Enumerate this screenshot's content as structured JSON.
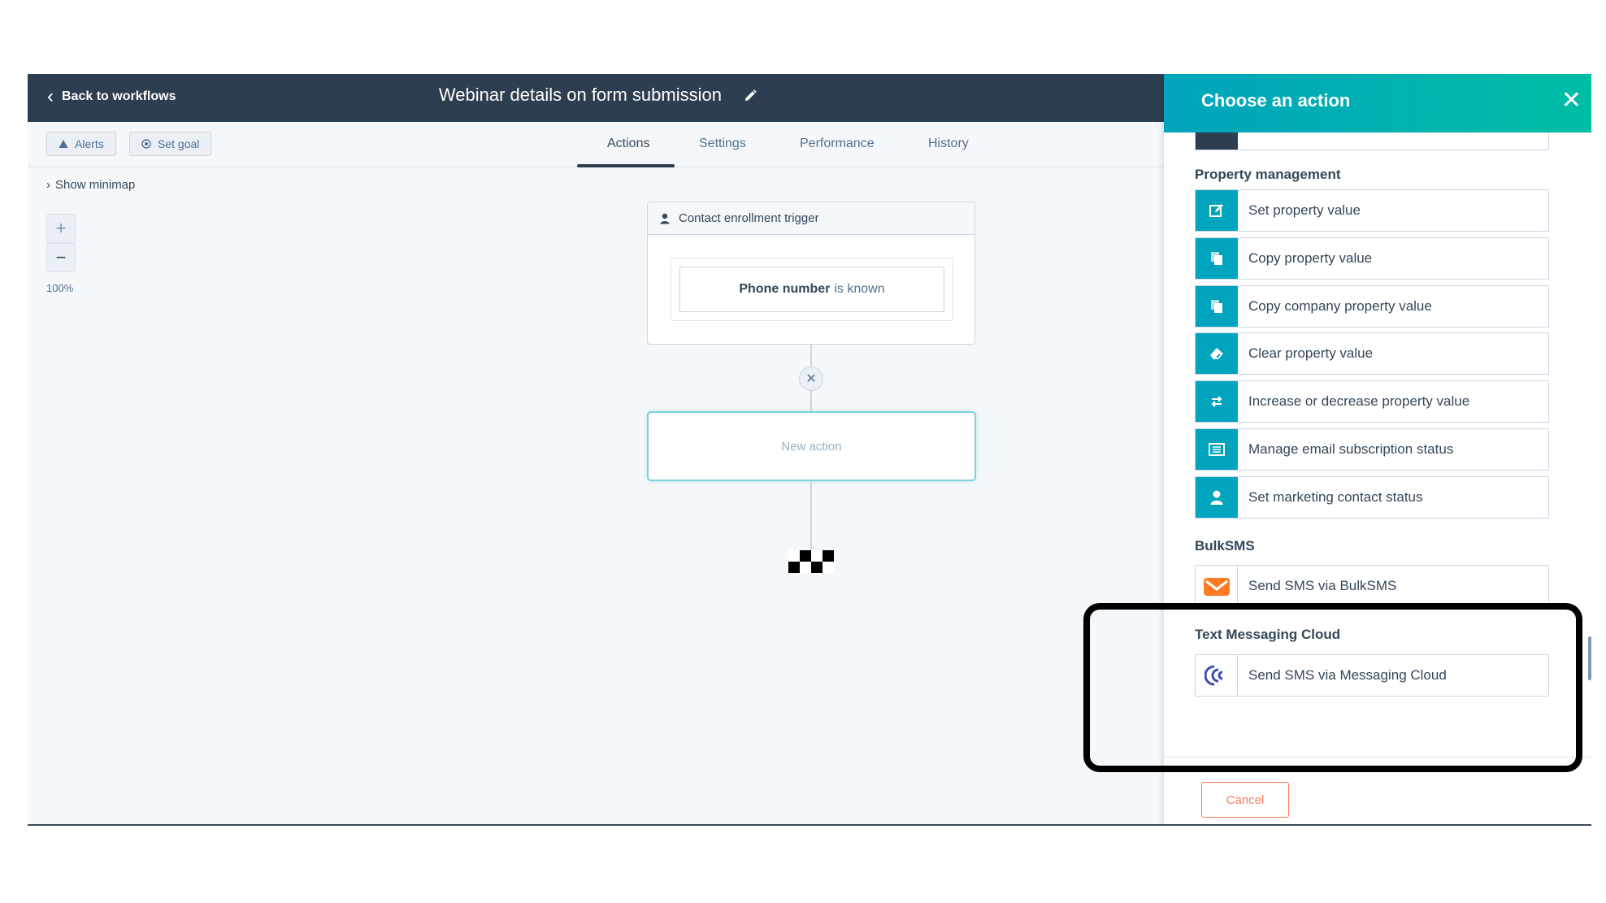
{
  "topbar": {
    "back_label": "Back to workflows",
    "title": "Webinar details on form submission"
  },
  "subbar": {
    "alerts_label": "Alerts",
    "goal_label": "Set goal",
    "tabs": [
      {
        "label": "Actions",
        "active": true
      },
      {
        "label": "Settings",
        "active": false
      },
      {
        "label": "Performance",
        "active": false
      },
      {
        "label": "History",
        "active": false
      }
    ]
  },
  "canvas": {
    "minimap_label": "Show minimap",
    "zoom_in": "+",
    "zoom_out": "−",
    "zoom_level": "100%",
    "trigger": {
      "title": "Contact enrollment trigger",
      "filter_property": "Phone number",
      "filter_operator": "is known"
    },
    "new_action_label": "New action"
  },
  "panel": {
    "title": "Choose an action",
    "sections": [
      {
        "title": "Property management",
        "items": [
          {
            "label": "Set property value",
            "icon": "edit-icon"
          },
          {
            "label": "Copy property value",
            "icon": "copy-icon"
          },
          {
            "label": "Copy company property value",
            "icon": "copy-icon"
          },
          {
            "label": "Clear property value",
            "icon": "eraser-icon"
          },
          {
            "label": "Increase or decrease property value",
            "icon": "swap-icon"
          },
          {
            "label": "Manage email subscription status",
            "icon": "newsletter-icon"
          },
          {
            "label": "Set marketing contact status",
            "icon": "contact-icon"
          }
        ]
      },
      {
        "title": "BulkSMS",
        "items": [
          {
            "label": "Send SMS via BulkSMS",
            "icon": "bulksms-logo-icon"
          }
        ]
      },
      {
        "title": "Text Messaging Cloud",
        "items": [
          {
            "label": "Send SMS via Messaging Cloud",
            "icon": "messaging-cloud-logo-icon"
          }
        ]
      }
    ],
    "cancel_label": "Cancel"
  },
  "colors": {
    "topbar": "#2d3e50",
    "accent": "#00a4bd",
    "accent_end": "#00bda5",
    "cancel": "#ff7a59"
  }
}
